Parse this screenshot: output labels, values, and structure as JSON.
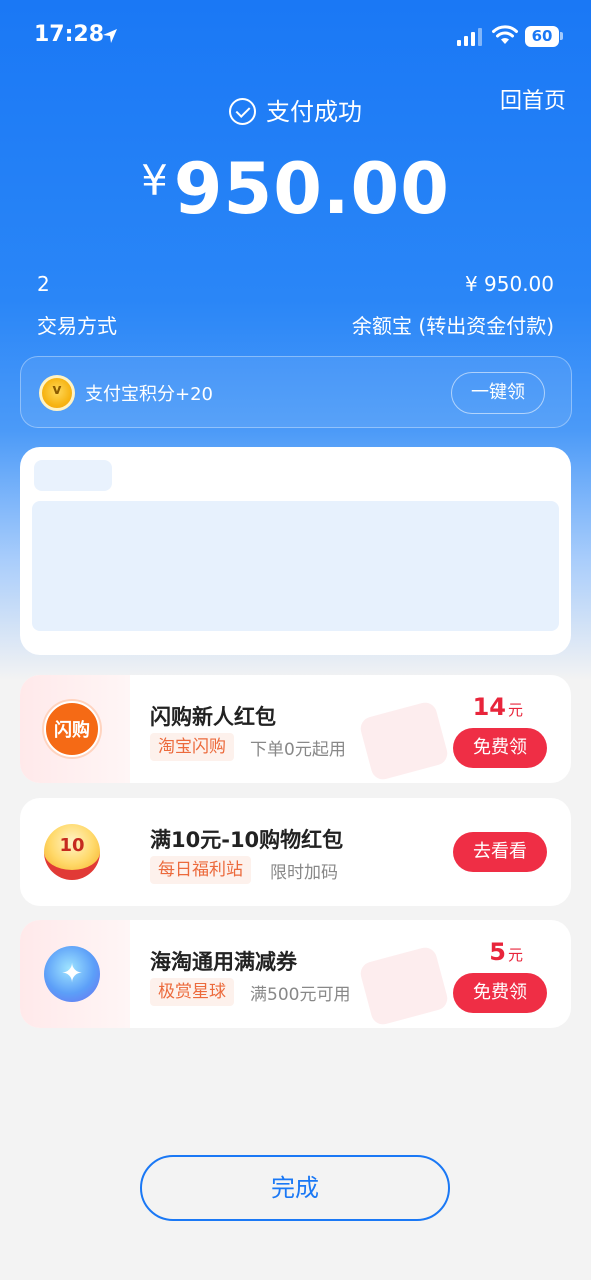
{
  "status_bar": {
    "time": "17:28",
    "battery": "60"
  },
  "header": {
    "home_link": "回首页",
    "success_text": "支付成功",
    "currency": "¥",
    "amount": "950.00"
  },
  "details": {
    "left_value": "2",
    "right_value": "¥ 950.00",
    "left_key": "交易方式",
    "right_key": "余额宝 (转出资金付款)"
  },
  "points": {
    "label": "支付宝积分+20",
    "button": "一键领"
  },
  "offers": [
    {
      "icon_text": "闪购",
      "title": "闪购新人红包",
      "tag": "淘宝闪购",
      "sub": "下单0元起用",
      "price": "14",
      "unit": "元",
      "button": "免费领"
    },
    {
      "icon_text": "10",
      "title": "满10元-10购物红包",
      "tag": "每日福利站",
      "sub": "限时加码",
      "price": "",
      "unit": "",
      "button": "去看看"
    },
    {
      "icon_text": "",
      "title": "海淘通用满减券",
      "tag": "极赏星球",
      "sub": "满500元可用",
      "price": "5",
      "unit": "元",
      "button": "免费领"
    }
  ],
  "footer": {
    "done_button": "完成"
  },
  "colors": {
    "primary_blue": "#1a78f5",
    "red": "#ef2e45",
    "orange_tag": "#ec6a3c"
  }
}
